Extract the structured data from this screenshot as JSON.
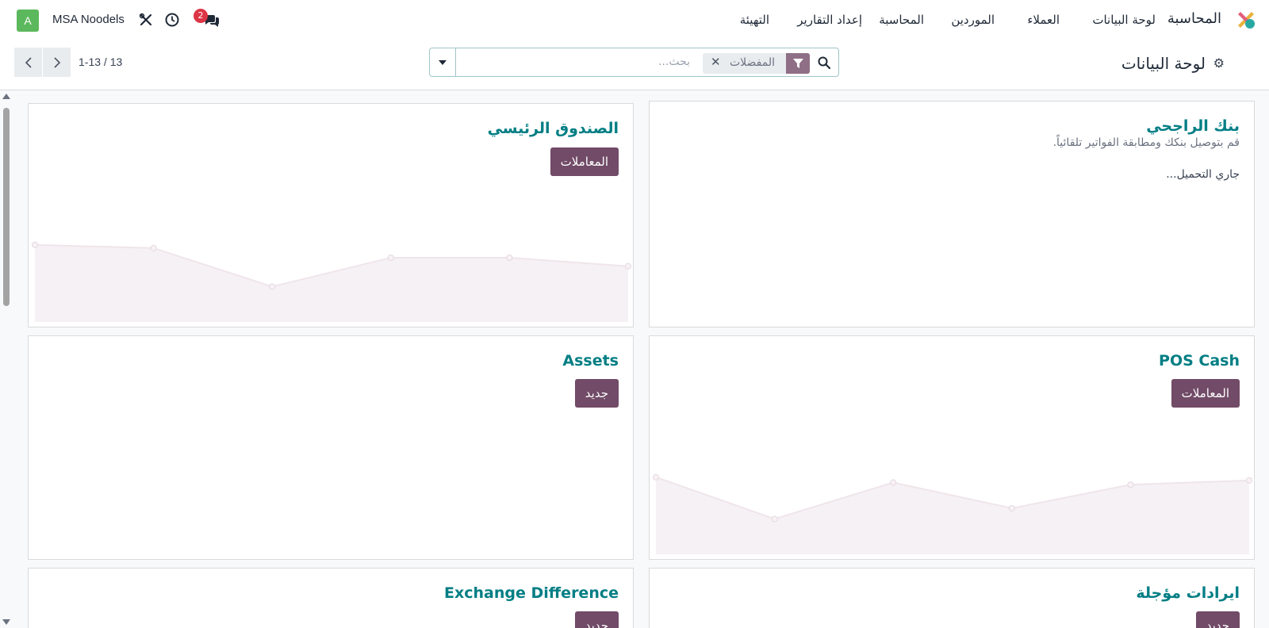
{
  "app": {
    "name": "المحاسبة",
    "menu": [
      "لوحة البيانات",
      "العملاء",
      "الموردين",
      "المحاسبة",
      "إعداد التقارير",
      "التهيئة"
    ],
    "user_initial": "A",
    "company": "MSA Noodels",
    "messages_badge": "2"
  },
  "control": {
    "page_title": "لوحة البيانات",
    "search_placeholder": "بحث...",
    "facet_label": "المفضلات",
    "pager": "1-13 / 13"
  },
  "cards": [
    {
      "title": "بنك الراجحي",
      "description": "قم بتوصيل بنكك ومطابقة الفواتير تلقائياً.",
      "loading": "جاري التحميل..."
    },
    {
      "title": "الصندوق الرئيسي",
      "button": "المعاملات",
      "chart_values": [
        0.72,
        0.69,
        0.33,
        0.6,
        0.6,
        0.52
      ]
    },
    {
      "title": "POS Cash",
      "button": "المعاملات",
      "chart_values": [
        0.72,
        0.33,
        0.67,
        0.43,
        0.65,
        0.69
      ]
    },
    {
      "title": "Assets",
      "button": "جديد"
    },
    {
      "title": "ايرادات مؤجلة",
      "button": "جديد"
    },
    {
      "title": "Exchange Difference",
      "button": "جديد"
    }
  ],
  "colors": {
    "brand": "#714b67",
    "teal": "#017e84",
    "badge": "#dc3545"
  }
}
